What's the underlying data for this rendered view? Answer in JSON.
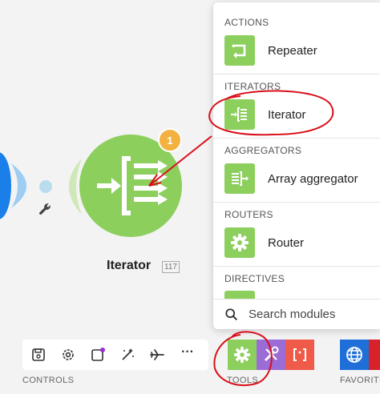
{
  "node": {
    "name": "Iterator",
    "id": "117",
    "badge": "1"
  },
  "panel": {
    "sections": [
      {
        "title": "ACTIONS",
        "items": [
          {
            "label": "Repeater",
            "icon": "repeat-icon"
          }
        ]
      },
      {
        "title": "ITERATORS",
        "items": [
          {
            "label": "Iterator",
            "icon": "iterator-icon"
          }
        ]
      },
      {
        "title": "AGGREGATORS",
        "items": [
          {
            "label": "Array aggregator",
            "icon": "array-aggregator-icon"
          }
        ]
      },
      {
        "title": "ROUTERS",
        "items": [
          {
            "label": "Router",
            "icon": "gear-icon"
          }
        ]
      },
      {
        "title": "DIRECTIVES",
        "items": []
      }
    ],
    "search_placeholder": "Search modules"
  },
  "toolbar": {
    "controls_label": "CONTROLS",
    "tools_label": "TOOLS",
    "favorites_label": "FAVORITE",
    "more_label": "···"
  },
  "colors": {
    "module_green": "#8ccf5d",
    "badge_orange": "#f3b23f",
    "annotation_red": "#d8101a",
    "text_parser_purple": "#9b6bd6",
    "json_red": "#f05a48",
    "http_blue": "#1f6fd9",
    "prev_node_blue": "#1a7fe8"
  }
}
